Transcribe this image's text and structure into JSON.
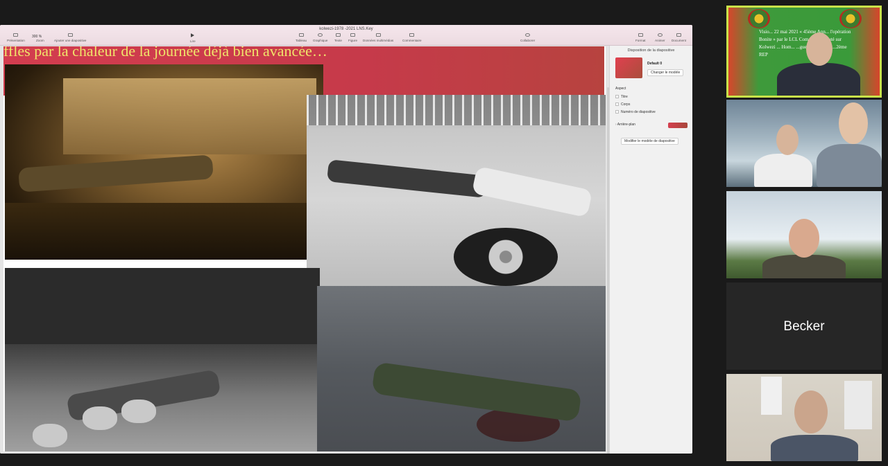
{
  "keynote": {
    "document_title": "kolwezi-1978 -2021 LNS.Key",
    "zoom_value": "300 %",
    "toolbar_left": [
      "Présentation",
      "Zoom",
      "Ajouter une diapositive"
    ],
    "play_label": "Lire",
    "toolbar_center": [
      "Tableau",
      "Graphique",
      "Texte",
      "Figure",
      "Données multimédias",
      "Commentaire"
    ],
    "collaborate_label": "Collaborer",
    "toolbar_right": [
      "Format",
      "Animer",
      "Document"
    ]
  },
  "slide": {
    "caption": "ffles par la chaleur de la journée déjà bien avancée…"
  },
  "inspector": {
    "title": "Disposition de la diapositive",
    "layout_name": "Default 0",
    "change_layout_button": "Changer le modèle",
    "aspect_label": "Aspect",
    "checkboxes": [
      "Titre",
      "Corps",
      "Numéro de diapositive"
    ],
    "background_label": "Arrière-plan",
    "edit_layout_button": "Modifier le modèle de diapositive",
    "background_color": "#c93f4c"
  },
  "participants": {
    "tile_4_name": "Becker",
    "tile_1_banner": "Visio... 22 mai 2021 « 45ème Ann... l'opération Bonite » par le LCL Coma... parachuté sur Kolwezi ... Hom... ...guerre et Hom... ...2ème REP",
    "active_speaker_border": "#c9e24a"
  }
}
